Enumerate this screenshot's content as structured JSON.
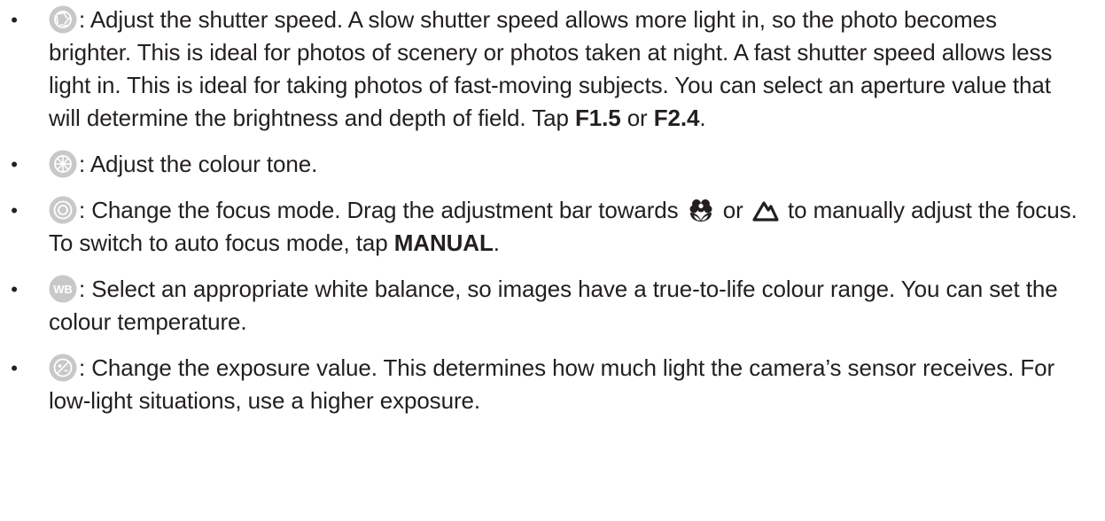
{
  "items": [
    {
      "icon": "shutter-speed-icon",
      "text_1": ": Adjust the shutter speed. A slow shutter speed allows more light in, so the photo becomes brighter. This is ideal for photos of scenery or photos taken at night. A fast shutter speed allows less light in. This is ideal for taking photos of fast-moving subjects. You can select an aperture value that will determine the brightness and depth of field. Tap ",
      "bold_1": "F1.5",
      "text_2": " or ",
      "bold_2": "F2.4",
      "text_3": "."
    },
    {
      "icon": "colour-tone-icon",
      "text_1": ": Adjust the colour tone."
    },
    {
      "icon": "focus-mode-icon",
      "text_1": ": Change the focus mode. Drag the adjustment bar towards ",
      "icon_macro": "macro-flower-icon",
      "text_2": " or ",
      "icon_landscape": "landscape-mountain-icon",
      "text_3": " to manually adjust the focus. To switch to auto focus mode, tap ",
      "bold_1": "MANUAL",
      "text_4": "."
    },
    {
      "icon": "white-balance-icon",
      "icon_text": "WB",
      "text_1": ": Select an appropriate white balance, so images have a true-to-life colour range. You can set the colour temperature."
    },
    {
      "icon": "exposure-icon",
      "text_1": ": Change the exposure value. This determines how much light the camera’s sensor receives. For low-light situations, use a higher exposure."
    }
  ],
  "colors": {
    "text": "#231f20",
    "icon_fill": "#c8c8c8",
    "icon_stroke": "#ffffff"
  }
}
